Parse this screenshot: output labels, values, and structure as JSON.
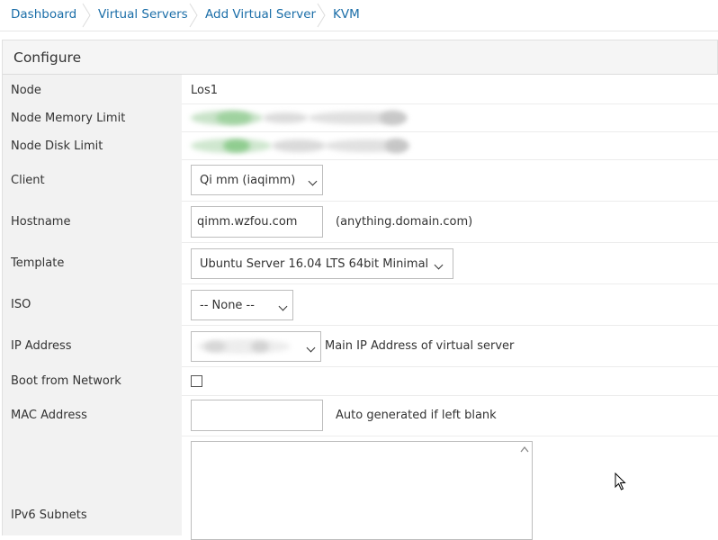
{
  "breadcrumb": [
    "Dashboard",
    "Virtual Servers",
    "Add Virtual Server",
    "KVM"
  ],
  "panel": {
    "title": "Configure"
  },
  "fields": {
    "node": {
      "label": "Node",
      "value": "Los1"
    },
    "node_memory": {
      "label": "Node Memory Limit"
    },
    "node_disk": {
      "label": "Node Disk Limit"
    },
    "client": {
      "label": "Client",
      "selected": "Qi mm (iaqimm)"
    },
    "hostname": {
      "label": "Hostname",
      "value": "qimm.wzfou.com",
      "hint": "(anything.domain.com)"
    },
    "template": {
      "label": "Template",
      "selected": "Ubuntu Server 16.04 LTS 64bit Minimal"
    },
    "iso": {
      "label": "ISO",
      "selected": "-- None --"
    },
    "ip": {
      "label": "IP Address",
      "hint": "Main IP Address of virtual server"
    },
    "boot": {
      "label": "Boot from Network"
    },
    "mac": {
      "label": "MAC Address",
      "value": "",
      "hint": "Auto generated if left blank"
    },
    "ipv6": {
      "label": "IPv6 Subnets",
      "value": ""
    }
  },
  "colors": {
    "link": "#1b6ea8",
    "label_bg": "#f2f2f2",
    "border": "#bdbdbd"
  }
}
